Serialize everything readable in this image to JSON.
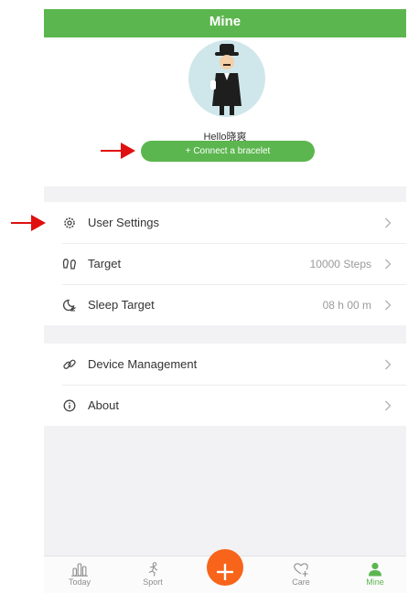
{
  "header": {
    "title": "Mine"
  },
  "profile": {
    "greeting": "Hello晓爽",
    "connect_label": "+ Connect a bracelet"
  },
  "settings": [
    {
      "label": "User Settings",
      "icon": "gear-icon",
      "value": ""
    },
    {
      "label": "Target",
      "icon": "shoes-icon",
      "value": "10000 Steps"
    },
    {
      "label": "Sleep Target",
      "icon": "moon-icon",
      "value": "08 h 00 m"
    }
  ],
  "device": [
    {
      "label": "Device Management",
      "icon": "link-icon"
    },
    {
      "label": "About",
      "icon": "info-icon"
    }
  ],
  "tabs": [
    {
      "label": "Today",
      "icon": "bar-chart-icon"
    },
    {
      "label": "Sport",
      "icon": "running-icon"
    },
    {
      "label": "",
      "icon": "plus-icon"
    },
    {
      "label": "Care",
      "icon": "heart-plus-icon"
    },
    {
      "label": "Mine",
      "icon": "person-icon",
      "active": true
    }
  ],
  "colors": {
    "brand_green": "#5cb64f",
    "plus_orange": "#f7641a",
    "annotation_red": "#e01010"
  }
}
